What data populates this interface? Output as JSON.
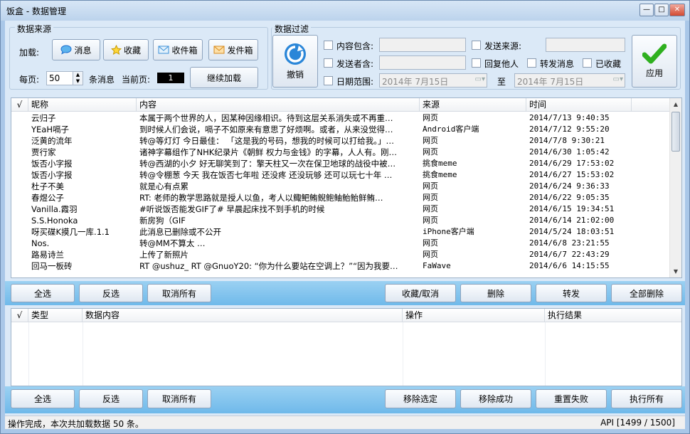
{
  "window": {
    "title": "饭盒 - 数据管理",
    "min": "—",
    "max": "□",
    "close": "✕"
  },
  "source": {
    "group_label": "数据来源",
    "load_label": "加载:",
    "buttons": {
      "messages": "消息",
      "favorites": "收藏",
      "inbox": "收件箱",
      "outbox": "发件箱"
    },
    "per_page_label": "每页:",
    "per_page_value": "50",
    "per_page_unit": "条消息",
    "current_page_label": "当前页:",
    "current_page_value": "1",
    "continue_load": "继续加载"
  },
  "filter": {
    "group_label": "数据过滤",
    "undo": "撤销",
    "content_contains": "内容包含:",
    "sender_contains": "发送者含:",
    "date_range": "日期范围:",
    "send_source": "发送来源:",
    "reply_others": "回复他人",
    "repost": "转发消息",
    "favorited": "已收藏",
    "date_from": "2014年 7月15日",
    "date_to_label": "至",
    "date_to": "2014年 7月15日",
    "apply": "应用"
  },
  "messages_table": {
    "columns": [
      "√",
      "昵称",
      "内容",
      "来源",
      "时间"
    ],
    "rows": [
      [
        "云归子",
        "本属于两个世界的人，因某种因缘相识。待到这层关系消失或不再重…",
        "网页",
        "2014/7/13 9:40:35"
      ],
      [
        "YEaH嗝子",
        "到时候人们会说，嗝子不如原来有意思了好烦啊。或者，从来没觉得…",
        "Android客户端",
        "2014/7/12 9:55:20"
      ],
      [
        "泛黄的流年",
        "转@等灯灯 今日最佳： 「这是我的号码，想我的时候可以打给我。」…",
        "网页",
        "2014/7/8 9:30:21"
      ],
      [
        "贾行家",
        "诸神字幕组作了NHK纪录片《朝鲜 权力与金钱》的字幕，人人有。刚…",
        "网页",
        "2014/6/30 1:05:42"
      ],
      [
        "饭否小字报",
        "转@西湖的小夕 好无聊笑到了：擎天柱又一次在保卫地球的战役中被…",
        "挑食meme",
        "2014/6/29 17:53:02"
      ],
      [
        "饭否小字报",
        "转@令棚葱 今天 我在饭否七年啦 还没疼 还没玩够 还可以玩七十年 …",
        "挑食meme",
        "2014/6/27 15:53:02"
      ],
      [
        "杜子不美",
        "就是心有点累",
        "网页",
        "2014/6/24 9:36:33"
      ],
      [
        "春煜公子",
        "RT: 老师的教学思路就是授人以鱼，考人以鲰鲃鲔鲵鲍鲉鲐鲐鲜鲔…",
        "网页",
        "2014/6/22 9:05:35"
      ],
      [
        "Vanilla.霞羽",
        "#听说饭否能发GIF了# 早晨起床找不到手机的时候",
        "网页",
        "2014/6/15 19:34:51"
      ],
      [
        "S.S.Honoka",
        "新房狗（GIF",
        "网页",
        "2014/6/14 21:02:00"
      ],
      [
        "呀买碟K摸几一库.1.1",
        "此消息已删除或不公开",
        "iPhone客户端",
        "2014/5/24 18:03:51"
      ],
      [
        "Nos.",
        "转@MM不算太  …",
        "网页",
        "2014/6/8 23:21:55"
      ],
      [
        "路易诗兰",
        "上传了新照片",
        "网页",
        "2014/6/7 22:43:29"
      ],
      [
        "回马一板砖",
        "RT @ushuz_ RT @GnuoY20: “你为什么要站在空调上？”“因为我要…",
        "FaWave",
        "2014/6/6 14:15:55"
      ]
    ]
  },
  "top_actions": {
    "select_all": "全选",
    "invert": "反选",
    "deselect_all": "取消所有",
    "toggle_favorite": "收藏/取消",
    "delete": "删除",
    "repost": "转发",
    "delete_all": "全部删除"
  },
  "tasks_table": {
    "columns": [
      "√",
      "类型",
      "数据内容",
      "操作",
      "执行结果"
    ]
  },
  "bottom_actions": {
    "select_all": "全选",
    "invert": "反选",
    "deselect_all": "取消所有",
    "remove_selected": "移除选定",
    "remove_success": "移除成功",
    "reset_failed": "重置失败",
    "execute_all": "执行所有"
  },
  "status": {
    "message": "操作完成，本次共加载数据 50 条。",
    "api": "API [1499 / 1500]"
  },
  "colors": {
    "accent": "#1e6fcf",
    "apply_green": "#2fb01f"
  }
}
